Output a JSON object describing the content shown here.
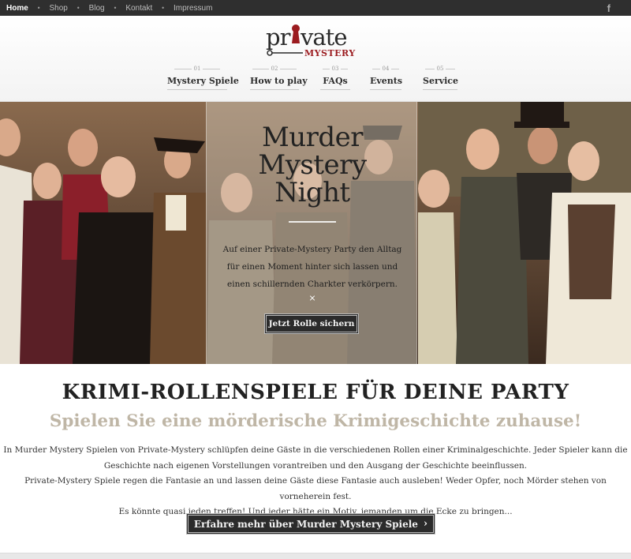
{
  "topbar": {
    "items": [
      {
        "label": "Home",
        "active": true
      },
      {
        "label": "Shop"
      },
      {
        "label": "Blog"
      },
      {
        "label": "Kontakt"
      },
      {
        "label": "Impressum"
      }
    ],
    "separator": "•",
    "social_icon": "facebook-icon",
    "social_glyph": "f"
  },
  "logo": {
    "word_top": "private",
    "word_bottom": "MYSTERY",
    "brand_dark": "#2b2b2b",
    "brand_red": "#9b1b1f"
  },
  "nav": [
    {
      "num": "01",
      "label": "Mystery Spiele"
    },
    {
      "num": "02",
      "label": "How to play"
    },
    {
      "num": "03",
      "label": "FAQs"
    },
    {
      "num": "04",
      "label": "Events"
    },
    {
      "num": "05",
      "label": "Service"
    }
  ],
  "hero": {
    "title_line1": "Murder",
    "title_line2": "Mystery",
    "title_line3": "Night",
    "text_line1": "Auf einer Private-Mystery Party den Alltag",
    "text_line2": "für einen Moment hinter sich lassen und",
    "text_line3": "einen schillernden Charkter verkörpern.",
    "close_glyph": "×",
    "button_label": "Jetzt Rolle sichern"
  },
  "content": {
    "heading": "KRIMI-ROLLENSPIELE FÜR DEINE PARTY",
    "subheading": "Spielen Sie eine mörderische Krimigeschichte zuhause!",
    "para_line1": "In Murder Mystery Spielen von Private-Mystery schlüpfen deine Gäste in die verschiedenen Rollen einer Kriminalgeschichte. Jeder Spieler kann die",
    "para_line2": "Geschichte nach eigenen Vorstellungen vorantreiben und den Ausgang der Geschichte beeinflussen.",
    "para_line3": "Private-Mystery Spiele regen die Fantasie an und lassen deine Gäste diese Fantasie auch ausleben! Weder Opfer, noch Mörder stehen von vorneherein fest.",
    "para_line4": "Es könnte quasi jeden treffen! Und jeder hätte ein Motiv, jemanden um die Ecke zu bringen...",
    "cta_label": "Erfahre mehr über Murder Mystery Spiele",
    "cta_chevron": "›"
  }
}
